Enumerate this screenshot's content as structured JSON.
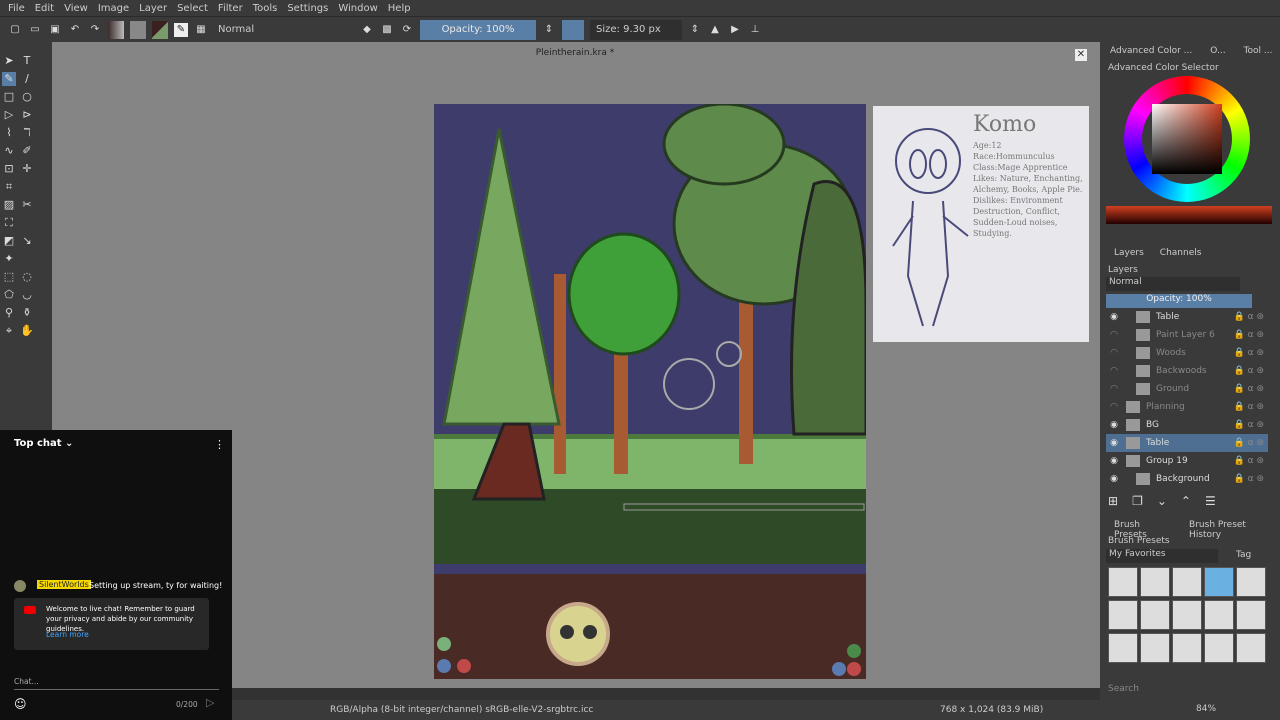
{
  "menu": [
    "File",
    "Edit",
    "View",
    "Image",
    "Layer",
    "Select",
    "Filter",
    "Tools",
    "Settings",
    "Window",
    "Help"
  ],
  "toolbar": {
    "blend_mode": "Normal",
    "opacity": "Opacity: 100%",
    "size": "Size: 9.30 px"
  },
  "document": {
    "title": "Pleintherain.kra *"
  },
  "reference_sheet": {
    "lettering": [
      "Komo",
      "Age:12",
      "Race:Hommunculus",
      "Class:Mage Apprentice",
      "Likes: Nature, Enchanting, Alchemy, Books, Apple Pie.",
      "Dislikes: Environment Destruction, Conflict, Sudden-Loud noises, Studying."
    ]
  },
  "right_panel": {
    "tabs": [
      "Advanced Color ...",
      "O...",
      "Tool ..."
    ],
    "color_selector_title": "Advanced Color Selector",
    "layer_tabs": [
      "Layers",
      "Channels"
    ],
    "layers_title": "Layers",
    "blend_mode": "Normal",
    "opacity": "Opacity:  100%",
    "layers": [
      {
        "name": "Table",
        "visible": true,
        "selected": false
      },
      {
        "name": "Paint Layer 6",
        "visible": false,
        "selected": false
      },
      {
        "name": "Woods",
        "visible": false,
        "selected": false
      },
      {
        "name": "Backwoods",
        "visible": false,
        "selected": false
      },
      {
        "name": "Ground",
        "visible": false,
        "selected": false
      },
      {
        "name": "Planning",
        "visible": false,
        "selected": false
      },
      {
        "name": "BG",
        "visible": true,
        "selected": false
      },
      {
        "name": "Table",
        "visible": true,
        "selected": true
      },
      {
        "name": "Group 19",
        "visible": true,
        "selected": false
      },
      {
        "name": "Background",
        "visible": true,
        "selected": false
      }
    ],
    "brush_tabs": [
      "Brush Presets",
      "Brush Preset History"
    ],
    "brush_title": "Brush Presets",
    "brush_filter": "My Favorites",
    "tag_label": "Tag",
    "search_placeholder": "Search",
    "zoom": "84%"
  },
  "chat": {
    "header": "Top chat",
    "messages": [
      {
        "author": "SilentWorlds",
        "text": "Setting up stream, ty for waiting!"
      }
    ],
    "notice": "Welcome to live chat! Remember to guard your privacy and abide by our community guidelines.",
    "learn_more": "Learn more",
    "input_placeholder": "Chat...",
    "counter": "0/200"
  },
  "status": {
    "color_space": "RGB/Alpha (8-bit integer/channel)  sRGB-elle-V2-srgbtrc.icc",
    "dimensions": "768 x 1,024 (83.9 MiB)"
  }
}
